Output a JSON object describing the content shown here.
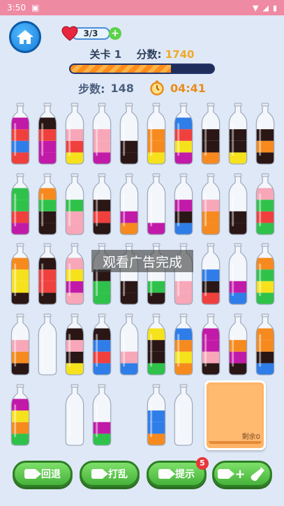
{
  "status": {
    "time": "3:50"
  },
  "hud": {
    "lives": "3/3",
    "level_label": "关卡",
    "level_value": "1",
    "score_label": "分数:",
    "score_value": "1740",
    "progress_fraction": 0.7,
    "steps_label": "步数:",
    "steps_value": "148",
    "timer": "04:41"
  },
  "overlay": {
    "text": "观看广告完成"
  },
  "remaining": {
    "label": "剩余0"
  },
  "buttons": {
    "undo": "回退",
    "shuffle": "打乱",
    "hint": "提示",
    "hint_badge": "5",
    "add_bottle": "+"
  },
  "colors": {
    "blue": "#2f7de8",
    "red": "#f0403e",
    "magenta": "#c21aa8",
    "black": "#2a1614",
    "yellow": "#f5e21c",
    "pink": "#f7a7b8",
    "orange": "#f68a1e",
    "green": "#2fc24a"
  },
  "bottles": [
    [
      "red",
      "blue",
      "red",
      "magenta"
    ],
    [
      "magenta",
      "magenta",
      "red",
      "black"
    ],
    [
      "yellow",
      "red",
      "pink"
    ],
    [
      "magenta",
      "pink",
      "pink"
    ],
    [
      "black",
      "black"
    ],
    [
      "yellow",
      "orange",
      "orange"
    ],
    [
      "magenta",
      "yellow",
      "red",
      "blue"
    ],
    [
      "orange",
      "black",
      "black"
    ],
    [
      "yellow",
      "black",
      "black"
    ],
    [
      "black",
      "orange",
      "black"
    ],
    [
      "magenta",
      "red",
      "green",
      "green"
    ],
    [
      "black",
      "black",
      "green",
      "orange"
    ],
    [
      "pink",
      "pink",
      "green"
    ],
    [
      "black",
      "red",
      "black"
    ],
    [
      "orange",
      "magenta"
    ],
    [
      "magenta"
    ],
    [
      "blue",
      "black",
      "magenta"
    ],
    [
      "orange",
      "orange",
      "pink"
    ],
    [
      "black",
      "black"
    ],
    [
      "green",
      "red",
      "green",
      "pink"
    ],
    [
      "black",
      "yellow",
      "yellow",
      "orange"
    ],
    [
      "black",
      "red",
      "red",
      "black"
    ],
    [
      "pink",
      "magenta",
      "yellow",
      "pink"
    ],
    [
      "green",
      "green",
      "black"
    ],
    [
      "black",
      "black"
    ],
    [
      "black",
      "green"
    ],
    [
      "pink",
      "pink"
    ],
    [
      "red",
      "black",
      "blue"
    ],
    [
      "blue",
      "magenta"
    ],
    [
      "green",
      "yellow",
      "green",
      "orange"
    ],
    [
      "black",
      "orange",
      "pink"
    ],
    [],
    [
      "yellow",
      "black",
      "pink",
      "black"
    ],
    [
      "blue",
      "red",
      "blue",
      "black"
    ],
    [
      "blue",
      "pink"
    ],
    [
      "green",
      "black",
      "black",
      "yellow"
    ],
    [
      "orange",
      "yellow",
      "orange",
      "blue"
    ],
    [
      "black",
      "pink",
      "magenta",
      "magenta"
    ],
    [
      "black",
      "magenta",
      "orange"
    ],
    [
      "blue",
      "black",
      "orange",
      "orange"
    ],
    [
      "green",
      "orange",
      "yellow",
      "magenta"
    ],
    [],
    [
      "green",
      "magenta"
    ],
    [
      "orange",
      "blue",
      "blue"
    ],
    [],
    [],
    []
  ]
}
